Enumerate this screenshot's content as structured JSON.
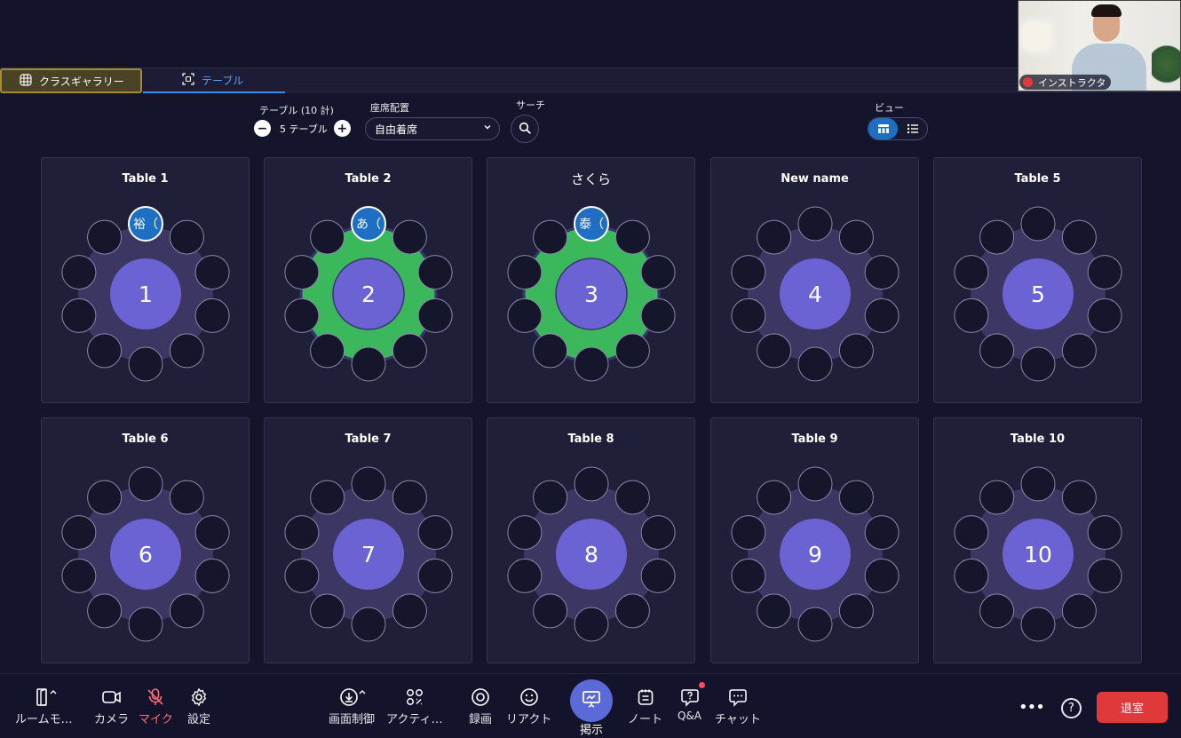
{
  "tabs": {
    "gallery_label": "クラスギャラリー",
    "table_label": "テーブル"
  },
  "video": {
    "name_label": "インストラクタ"
  },
  "controls": {
    "tables_label": "テーブル (10 計)",
    "tables_value": "5 テーブル",
    "minus": "−",
    "plus": "+",
    "seating_label": "座席配置",
    "seating_value": "自由着席",
    "search_label": "サーチ",
    "view_label": "ビュー"
  },
  "tables": [
    {
      "title": "Table 1",
      "number": "1",
      "highlight": false,
      "seated": "裕（"
    },
    {
      "title": "Table 2",
      "number": "2",
      "highlight": true,
      "seated": "あ（"
    },
    {
      "title": "さくら",
      "number": "3",
      "highlight": true,
      "seated": "泰（"
    },
    {
      "title": "New name",
      "number": "4",
      "highlight": false,
      "seated": ""
    },
    {
      "title": "Table 5",
      "number": "5",
      "highlight": false,
      "seated": ""
    },
    {
      "title": "Table 6",
      "number": "6",
      "highlight": false,
      "seated": ""
    },
    {
      "title": "Table 7",
      "number": "7",
      "highlight": false,
      "seated": ""
    },
    {
      "title": "Table 8",
      "number": "8",
      "highlight": false,
      "seated": ""
    },
    {
      "title": "Table 9",
      "number": "9",
      "highlight": false,
      "seated": ""
    },
    {
      "title": "Table 10",
      "number": "10",
      "highlight": false,
      "seated": ""
    }
  ],
  "bottombar": {
    "room_mode": "ルームモ…",
    "camera": "カメラ",
    "mic": "マイク",
    "settings": "設定",
    "screen_control": "画面制御",
    "activity": "アクティ…",
    "record": "録画",
    "reaction": "リアクト",
    "present": "掲示",
    "note": "ノート",
    "qa": "Q&A",
    "chat": "チャット",
    "more": "•••",
    "help": "?",
    "leave": "退室"
  },
  "colors": {
    "accent_blue": "#1e6fc4",
    "table_purple": "#6b63d4",
    "highlight_green": "#3cb85c",
    "leave_red": "#e0393b",
    "background": "#14142c"
  }
}
